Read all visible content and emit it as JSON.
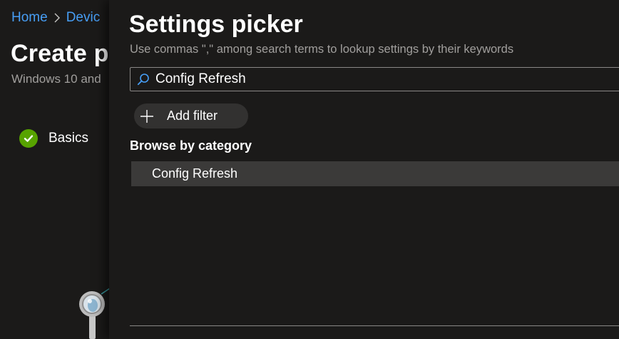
{
  "breadcrumb": {
    "home": "Home",
    "devices": "Devic"
  },
  "page": {
    "title": "Create p",
    "subtitle": "Windows 10 and"
  },
  "steps": [
    {
      "label": "Basics",
      "status": "complete"
    }
  ],
  "blade": {
    "title": "Settings picker",
    "description": "Use commas \",\" among search terms to lookup settings by their keywords",
    "search": {
      "value": "Config Refresh",
      "placeholder": ""
    },
    "add_filter_label": "Add filter",
    "browse_heading": "Browse by category",
    "categories": [
      {
        "label": "Config Refresh",
        "selected": true
      }
    ]
  },
  "colors": {
    "accent": "#479ef5",
    "success": "#57a300",
    "background": "#1b1a19",
    "selected_row": "#3b3a39"
  },
  "icons": {
    "breadcrumb_separator": "chevron-right-icon",
    "step_status": "checkmark-circle-icon",
    "search": "search-icon",
    "add": "plus-icon",
    "illustration": "magnifier-illustration-icon"
  }
}
